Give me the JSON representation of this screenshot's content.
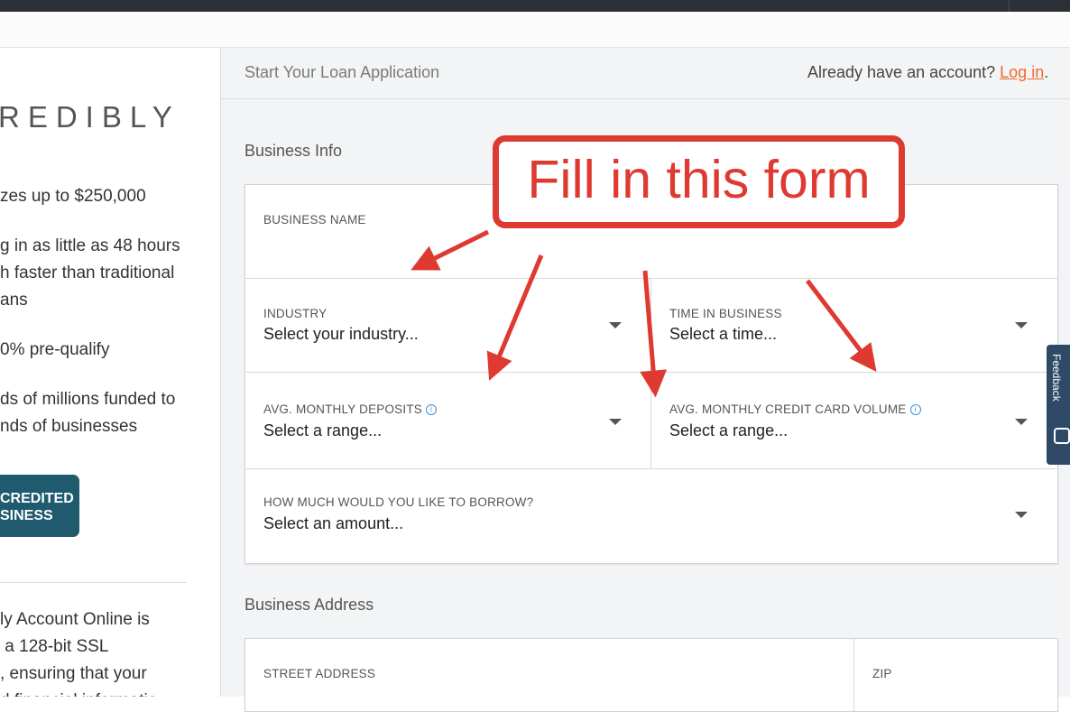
{
  "browser": {},
  "sidebar": {
    "logo": "REDIBLY",
    "features": [
      "zes up to $250,000",
      "g in as little as 48 hours",
      "h faster than traditional",
      "ans",
      "0% pre-qualify",
      "ds of millions funded to",
      "nds of businesses"
    ],
    "badge_line1": "CREDITED",
    "badge_line2": "SINESS",
    "security_lines": [
      "ly Account Online is",
      " a 128-bit SSL",
      ", ensuring that your",
      "d financial informatio"
    ]
  },
  "header": {
    "title": "Start Your Loan Application",
    "account_prompt": "Already have an account? ",
    "login_link": "Log in",
    "period": "."
  },
  "business_info": {
    "title": "Business Info",
    "business_name_label": "BUSINESS NAME",
    "industry_label": "INDUSTRY",
    "industry_value": "Select your industry...",
    "time_label": "TIME IN BUSINESS",
    "time_value": "Select a time...",
    "deposits_label": "AVG. MONTHLY DEPOSITS",
    "deposits_value": "Select a range...",
    "cc_label": "AVG. MONTHLY CREDIT CARD VOLUME",
    "cc_value": "Select a range...",
    "borrow_label": "HOW MUCH WOULD YOU LIKE TO BORROW?",
    "borrow_value": "Select an amount..."
  },
  "business_address": {
    "title": "Business Address",
    "street_label": "STREET ADDRESS",
    "zip_label": "ZIP"
  },
  "feedback": {
    "label": "Feedback"
  },
  "annotation": {
    "text": "Fill in this form",
    "color": "#de3a32"
  },
  "colors": {
    "accent_link": "#ee6a2a",
    "badge": "#1f5a6e",
    "info_icon": "#3d8fd6"
  }
}
